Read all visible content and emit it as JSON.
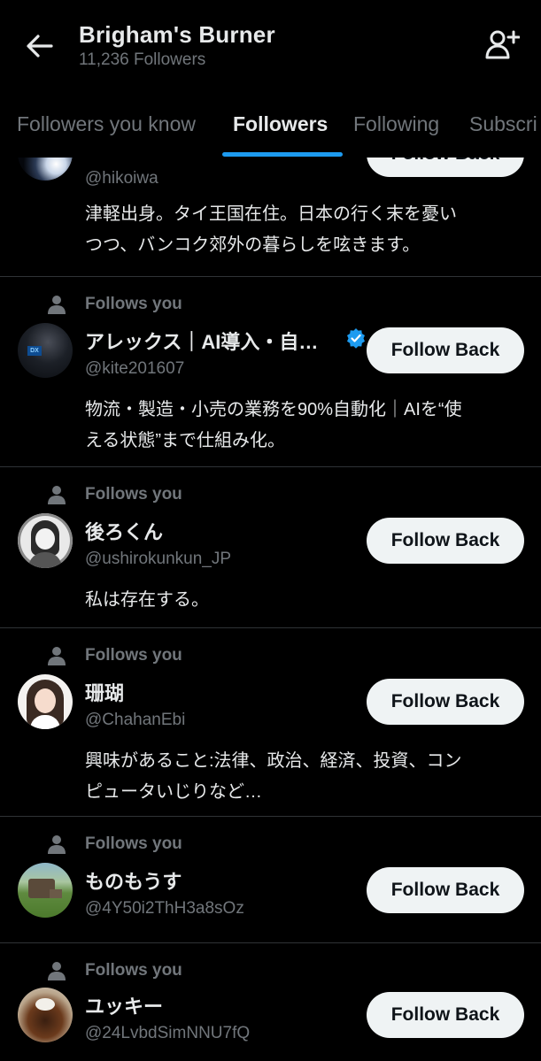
{
  "header": {
    "title": "Brigham's Burner",
    "followers": "11,236 Followers"
  },
  "tabs": [
    "Followers you know",
    "Followers",
    "Following",
    "Subscri"
  ],
  "follow_back_label": "Follow Back",
  "follows_you_label": "Follows you",
  "users": [
    {
      "name": "",
      "handle": "@hikoiwa",
      "bio_lines": [
        "津軽出身。タイ王国在住。日本の行く末を憂い",
        "つつ、バンコク郊外の暮らしを呟きます。"
      ]
    },
    {
      "name": "アレックス｜AI導入・自…",
      "handle": "@kite201607",
      "verified": true,
      "avatar_text": "DX",
      "bio_lines": [
        "物流・製造・小売の業務を90%自動化｜AIを“使",
        "える状態”まで仕組み化。"
      ]
    },
    {
      "name": "後ろくん",
      "handle": "@ushirokunkun_JP",
      "bio_lines": [
        "私は存在する。"
      ]
    },
    {
      "name": "珊瑚",
      "handle": "@ChahanEbi",
      "bio_lines": [
        "興味があること:法律、政治、経済、投資、コン",
        "ピュータいじりなど…"
      ]
    },
    {
      "name": "ものもうす",
      "handle": "@4Y50i2ThH3a8sOz",
      "bio_lines": []
    },
    {
      "name": "ユッキー",
      "handle": "@24LvbdSimNNU7fQ",
      "bio_lines": []
    }
  ],
  "colors": {
    "background": "#000000",
    "accent": "#1d9bf0",
    "muted": "#71767b",
    "button_bg": "#eff3f4",
    "divider": "#2f3336"
  }
}
